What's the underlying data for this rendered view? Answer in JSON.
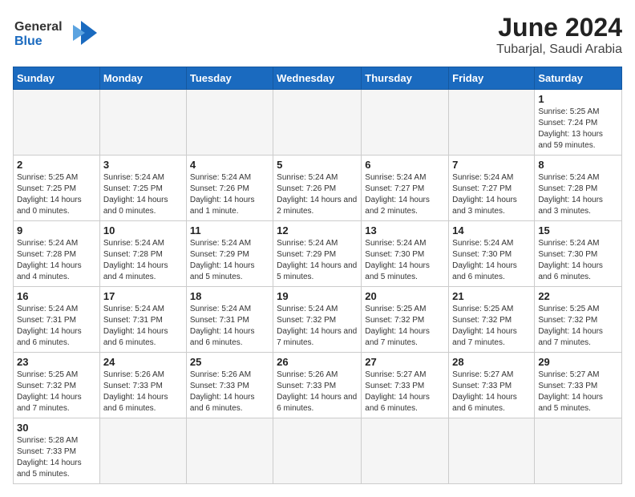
{
  "header": {
    "logo_general": "General",
    "logo_blue": "Blue",
    "title": "June 2024",
    "subtitle": "Tubarjal, Saudi Arabia"
  },
  "weekdays": [
    "Sunday",
    "Monday",
    "Tuesday",
    "Wednesday",
    "Thursday",
    "Friday",
    "Saturday"
  ],
  "weeks": [
    [
      {
        "day": "",
        "empty": true
      },
      {
        "day": "",
        "empty": true
      },
      {
        "day": "",
        "empty": true
      },
      {
        "day": "",
        "empty": true
      },
      {
        "day": "",
        "empty": true
      },
      {
        "day": "",
        "empty": true
      },
      {
        "day": "1",
        "sunrise": "5:25 AM",
        "sunset": "7:24 PM",
        "daylight": "13 hours and 59 minutes."
      }
    ],
    [
      {
        "day": "2",
        "sunrise": "5:25 AM",
        "sunset": "7:25 PM",
        "daylight": "14 hours and 0 minutes."
      },
      {
        "day": "3",
        "sunrise": "5:24 AM",
        "sunset": "7:25 PM",
        "daylight": "14 hours and 0 minutes."
      },
      {
        "day": "4",
        "sunrise": "5:24 AM",
        "sunset": "7:26 PM",
        "daylight": "14 hours and 1 minute."
      },
      {
        "day": "5",
        "sunrise": "5:24 AM",
        "sunset": "7:26 PM",
        "daylight": "14 hours and 2 minutes."
      },
      {
        "day": "6",
        "sunrise": "5:24 AM",
        "sunset": "7:27 PM",
        "daylight": "14 hours and 2 minutes."
      },
      {
        "day": "7",
        "sunrise": "5:24 AM",
        "sunset": "7:27 PM",
        "daylight": "14 hours and 3 minutes."
      },
      {
        "day": "8",
        "sunrise": "5:24 AM",
        "sunset": "7:28 PM",
        "daylight": "14 hours and 3 minutes."
      }
    ],
    [
      {
        "day": "9",
        "sunrise": "5:24 AM",
        "sunset": "7:28 PM",
        "daylight": "14 hours and 4 minutes."
      },
      {
        "day": "10",
        "sunrise": "5:24 AM",
        "sunset": "7:28 PM",
        "daylight": "14 hours and 4 minutes."
      },
      {
        "day": "11",
        "sunrise": "5:24 AM",
        "sunset": "7:29 PM",
        "daylight": "14 hours and 5 minutes."
      },
      {
        "day": "12",
        "sunrise": "5:24 AM",
        "sunset": "7:29 PM",
        "daylight": "14 hours and 5 minutes."
      },
      {
        "day": "13",
        "sunrise": "5:24 AM",
        "sunset": "7:30 PM",
        "daylight": "14 hours and 5 minutes."
      },
      {
        "day": "14",
        "sunrise": "5:24 AM",
        "sunset": "7:30 PM",
        "daylight": "14 hours and 6 minutes."
      },
      {
        "day": "15",
        "sunrise": "5:24 AM",
        "sunset": "7:30 PM",
        "daylight": "14 hours and 6 minutes."
      }
    ],
    [
      {
        "day": "16",
        "sunrise": "5:24 AM",
        "sunset": "7:31 PM",
        "daylight": "14 hours and 6 minutes."
      },
      {
        "day": "17",
        "sunrise": "5:24 AM",
        "sunset": "7:31 PM",
        "daylight": "14 hours and 6 minutes."
      },
      {
        "day": "18",
        "sunrise": "5:24 AM",
        "sunset": "7:31 PM",
        "daylight": "14 hours and 6 minutes."
      },
      {
        "day": "19",
        "sunrise": "5:24 AM",
        "sunset": "7:32 PM",
        "daylight": "14 hours and 7 minutes."
      },
      {
        "day": "20",
        "sunrise": "5:25 AM",
        "sunset": "7:32 PM",
        "daylight": "14 hours and 7 minutes."
      },
      {
        "day": "21",
        "sunrise": "5:25 AM",
        "sunset": "7:32 PM",
        "daylight": "14 hours and 7 minutes."
      },
      {
        "day": "22",
        "sunrise": "5:25 AM",
        "sunset": "7:32 PM",
        "daylight": "14 hours and 7 minutes."
      }
    ],
    [
      {
        "day": "23",
        "sunrise": "5:25 AM",
        "sunset": "7:32 PM",
        "daylight": "14 hours and 7 minutes."
      },
      {
        "day": "24",
        "sunrise": "5:26 AM",
        "sunset": "7:33 PM",
        "daylight": "14 hours and 6 minutes."
      },
      {
        "day": "25",
        "sunrise": "5:26 AM",
        "sunset": "7:33 PM",
        "daylight": "14 hours and 6 minutes."
      },
      {
        "day": "26",
        "sunrise": "5:26 AM",
        "sunset": "7:33 PM",
        "daylight": "14 hours and 6 minutes."
      },
      {
        "day": "27",
        "sunrise": "5:27 AM",
        "sunset": "7:33 PM",
        "daylight": "14 hours and 6 minutes."
      },
      {
        "day": "28",
        "sunrise": "5:27 AM",
        "sunset": "7:33 PM",
        "daylight": "14 hours and 6 minutes."
      },
      {
        "day": "29",
        "sunrise": "5:27 AM",
        "sunset": "7:33 PM",
        "daylight": "14 hours and 5 minutes."
      }
    ],
    [
      {
        "day": "30",
        "sunrise": "5:28 AM",
        "sunset": "7:33 PM",
        "daylight": "14 hours and 5 minutes."
      },
      {
        "day": "",
        "empty": true
      },
      {
        "day": "",
        "empty": true
      },
      {
        "day": "",
        "empty": true
      },
      {
        "day": "",
        "empty": true
      },
      {
        "day": "",
        "empty": true
      },
      {
        "day": "",
        "empty": true
      }
    ]
  ],
  "labels": {
    "sunrise": "Sunrise:",
    "sunset": "Sunset:",
    "daylight": "Daylight:"
  },
  "colors": {
    "header_bg": "#1a6abf",
    "logo_blue": "#1a6abf"
  }
}
